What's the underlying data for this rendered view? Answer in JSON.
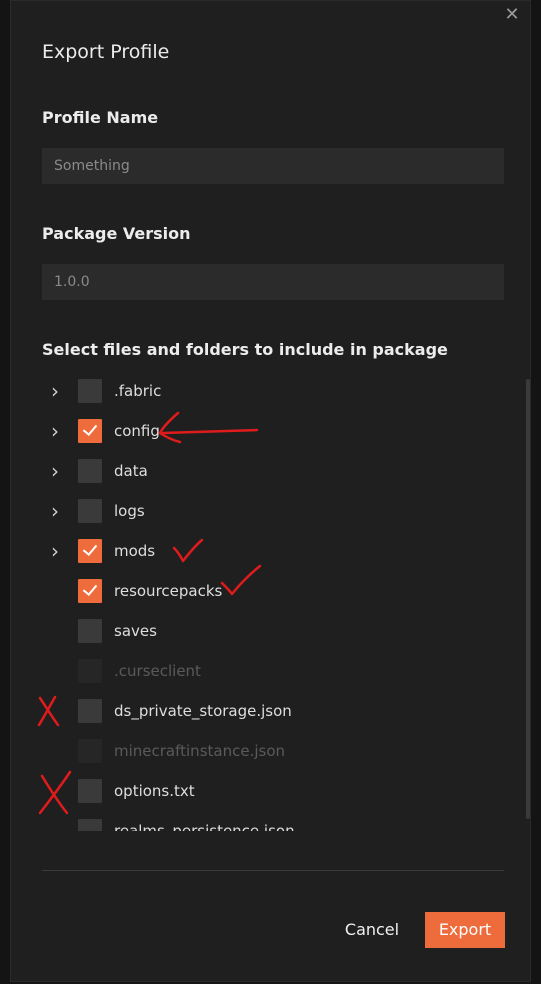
{
  "dialog": {
    "title": "Export Profile",
    "close_icon": "close-icon",
    "profile_name_label": "Profile Name",
    "profile_name_placeholder": "Something",
    "profile_name_value": "",
    "package_version_label": "Package Version",
    "package_version_placeholder": "1.0.0",
    "package_version_value": "",
    "select_label": "Select files and folders to include in package",
    "items": [
      {
        "name": ".fabric",
        "expandable": true,
        "checked": false,
        "disabled": false
      },
      {
        "name": "config",
        "expandable": true,
        "checked": true,
        "disabled": false
      },
      {
        "name": "data",
        "expandable": true,
        "checked": false,
        "disabled": false
      },
      {
        "name": "logs",
        "expandable": true,
        "checked": false,
        "disabled": false
      },
      {
        "name": "mods",
        "expandable": true,
        "checked": true,
        "disabled": false
      },
      {
        "name": "resourcepacks",
        "expandable": false,
        "checked": true,
        "disabled": false
      },
      {
        "name": "saves",
        "expandable": false,
        "checked": false,
        "disabled": false
      },
      {
        "name": ".curseclient",
        "expandable": false,
        "checked": false,
        "disabled": true
      },
      {
        "name": "ds_private_storage.json",
        "expandable": false,
        "checked": false,
        "disabled": false
      },
      {
        "name": "minecraftinstance.json",
        "expandable": false,
        "checked": false,
        "disabled": true
      },
      {
        "name": "options.txt",
        "expandable": false,
        "checked": false,
        "disabled": false
      },
      {
        "name": "realms_persistence.json",
        "expandable": false,
        "checked": false,
        "disabled": false
      }
    ],
    "cancel_label": "Cancel",
    "export_label": "Export"
  },
  "colors": {
    "accent": "#ee6b3b",
    "annotation": "#e01b1b"
  }
}
